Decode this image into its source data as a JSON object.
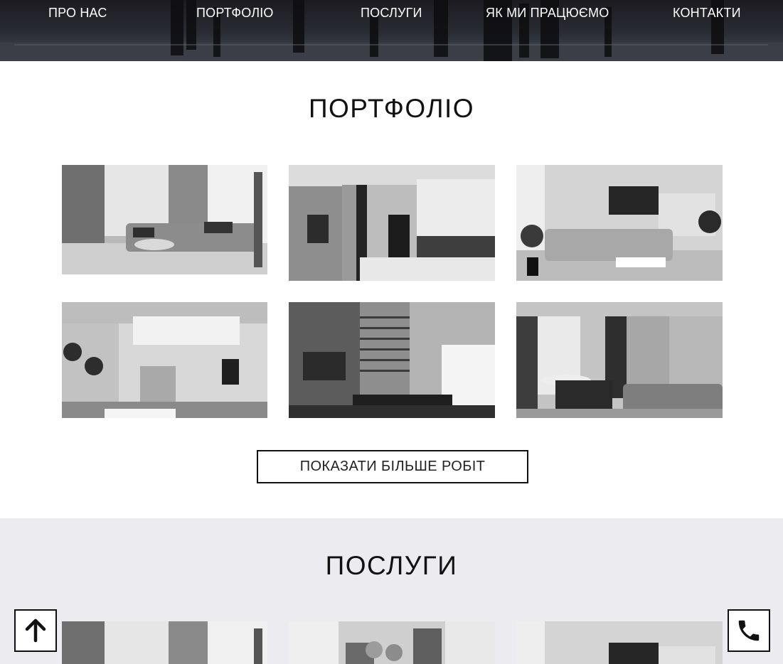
{
  "nav": {
    "items": [
      {
        "label": "ПРО НАС"
      },
      {
        "label": "ПОРТФОЛІО"
      },
      {
        "label": "ПОСЛУГИ"
      },
      {
        "label": "ЯК МИ ПРАЦЮЄМО"
      },
      {
        "label": "КОНТАКТИ"
      }
    ]
  },
  "portfolio": {
    "title": "ПОРТФОЛІО",
    "more_button": "ПОКАЗАТИ БІЛЬШЕ РОБІТ"
  },
  "services": {
    "title": "ПОСЛУГИ"
  },
  "floating": {
    "up_icon": "arrow-up-icon",
    "phone_icon": "phone-icon"
  }
}
